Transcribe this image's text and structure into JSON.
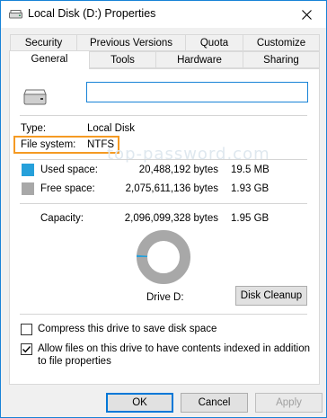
{
  "window": {
    "title": "Local Disk (D:) Properties"
  },
  "tabs_row1": [
    {
      "label": "Security"
    },
    {
      "label": "Previous Versions"
    },
    {
      "label": "Quota"
    },
    {
      "label": "Customize"
    }
  ],
  "tabs_row2": [
    {
      "label": "General",
      "active": true
    },
    {
      "label": "Tools"
    },
    {
      "label": "Hardware"
    },
    {
      "label": "Sharing"
    }
  ],
  "general": {
    "name_value": "",
    "type_label": "Type:",
    "type_value": "Local Disk",
    "fs_label": "File system:",
    "fs_value": "NTFS",
    "used_label": "Used space:",
    "used_bytes": "20,488,192 bytes",
    "used_size": "19.5 MB",
    "free_label": "Free space:",
    "free_bytes": "2,075,611,136 bytes",
    "free_size": "1.93 GB",
    "capacity_label": "Capacity:",
    "capacity_bytes": "2,096,099,328 bytes",
    "capacity_size": "1.95 GB",
    "drive_label": "Drive D:",
    "disk_cleanup_label": "Disk Cleanup",
    "compress_label": "Compress this drive to save disk space",
    "compress_checked": false,
    "index_label_line1": "Allow files on this drive to have contents indexed in addition",
    "index_label_line2": "to file properties",
    "index_checked": true,
    "used_fraction": 0.0098
  },
  "watermark": "top-password.com",
  "buttons": {
    "ok": "OK",
    "cancel": "Cancel",
    "apply": "Apply"
  },
  "colors": {
    "used": "#26a0da",
    "free": "#a8a8a8",
    "highlight": "#f59a23",
    "accent": "#1883d7"
  }
}
